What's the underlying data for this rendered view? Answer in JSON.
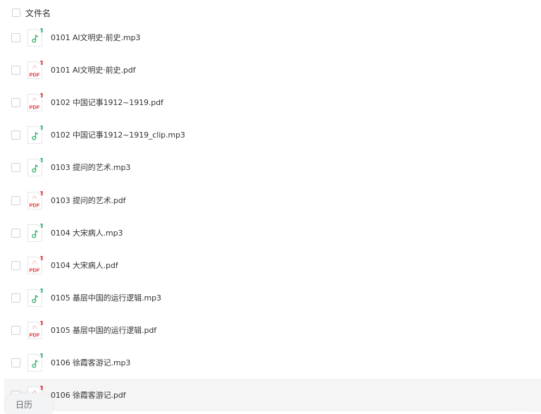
{
  "header": {
    "column_label": "文件名"
  },
  "files": [
    {
      "name": "0101 AI文明史·前史.mp3",
      "type": "mp3"
    },
    {
      "name": "0101 AI文明史·前史.pdf",
      "type": "pdf"
    },
    {
      "name": "0102 中国记事1912~1919.pdf",
      "type": "pdf"
    },
    {
      "name": "0102 中国记事1912~1919_clip.mp3",
      "type": "mp3"
    },
    {
      "name": "0103 提问的艺术.mp3",
      "type": "mp3"
    },
    {
      "name": "0103 提问的艺术.pdf",
      "type": "pdf"
    },
    {
      "name": "0104 大宋病人.mp3",
      "type": "mp3"
    },
    {
      "name": "0104 大宋病人.pdf",
      "type": "pdf"
    },
    {
      "name": "0105 基层中国的运行逻辑.mp3",
      "type": "mp3"
    },
    {
      "name": "0105 基层中国的运行逻辑.pdf",
      "type": "pdf"
    },
    {
      "name": "0106 徐霞客游记.mp3",
      "type": "mp3"
    },
    {
      "name": "0106 徐霞客游记.pdf",
      "type": "pdf"
    }
  ],
  "icons": {
    "mp3": "music-file-icon",
    "pdf": "pdf-file-icon"
  },
  "pdf_icon_text": "PDF",
  "colors": {
    "mp3_accent": "#3cb371",
    "pdf_accent": "#e03c3c"
  },
  "bottom_tab": {
    "label": "日历"
  }
}
